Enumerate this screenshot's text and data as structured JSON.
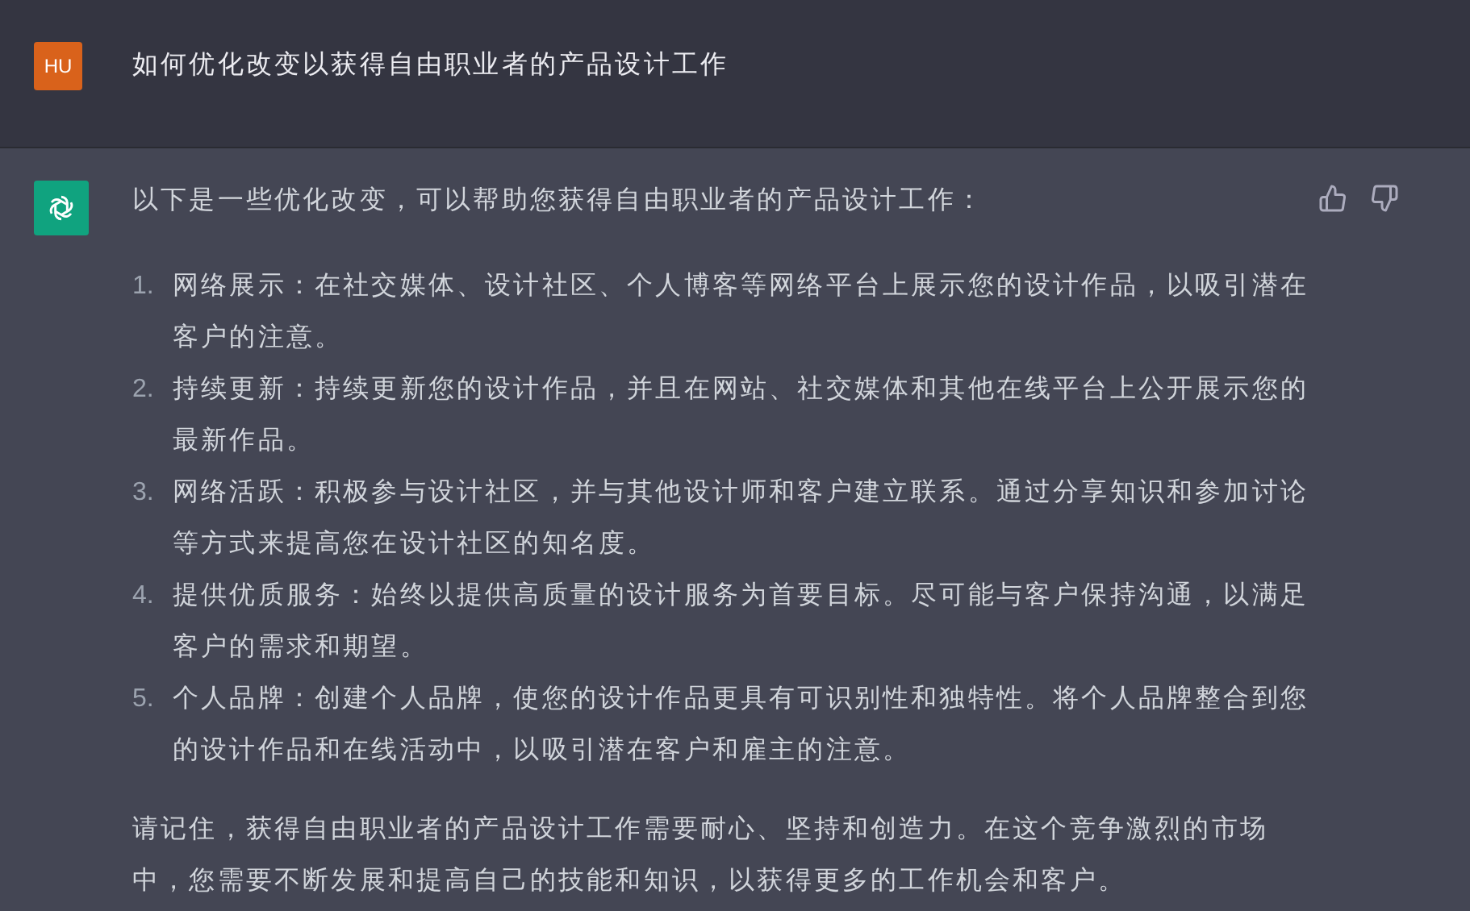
{
  "question": {
    "avatar": "HU",
    "text": "如何优化改变以获得自由职业者的产品设计工作"
  },
  "answer": {
    "intro": "以下是一些优化改变，可以帮助您获得自由职业者的产品设计工作：",
    "items": [
      {
        "number": "1.",
        "text": "网络展示：在社交媒体、设计社区、个人博客等网络平台上展示您的设计作品，以吸引潜在客户的注意。"
      },
      {
        "number": "2.",
        "text": "持续更新：持续更新您的设计作品，并且在网站、社交媒体和其他在线平台上公开展示您的最新作品。"
      },
      {
        "number": "3.",
        "text": "网络活跃：积极参与设计社区，并与其他设计师和客户建立联系。通过分享知识和参加讨论等方式来提高您在设计社区的知名度。"
      },
      {
        "number": "4.",
        "text": "提供优质服务：始终以提供高质量的设计服务为首要目标。尽可能与客户保持沟通，以满足客户的需求和期望。"
      },
      {
        "number": "5.",
        "text": "个人品牌：创建个人品牌，使您的设计作品更具有可识别性和独特性。将个人品牌整合到您的设计作品和在线活动中，以吸引潜在客户和雇主的注意。"
      }
    ],
    "closing": "请记住，获得自由职业者的产品设计工作需要耐心、坚持和创造力。在这个竞争激烈的市场中，您需要不断发展和提高自己的技能和知识，以获得更多的工作机会和客户。"
  }
}
